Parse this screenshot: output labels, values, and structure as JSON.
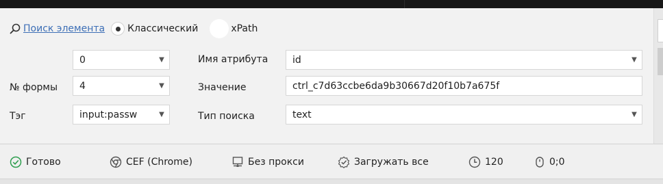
{
  "search": {
    "link_label": "Поиск элемента",
    "mode_classic": "Классический",
    "mode_xpath": "xPath",
    "selected_mode": "classic"
  },
  "form": {
    "index_value": "0",
    "form_number_label": "№ формы",
    "form_number_value": "4",
    "tag_label": "Тэг",
    "tag_value": "input:passw",
    "attr_name_label": "Имя атрибута",
    "attr_name_value": "id",
    "value_label": "Значение",
    "value_value": "ctrl_c7d63ccbe6da9b30667d20f10b7a675f",
    "search_type_label": "Тип поиска",
    "search_type_value": "text"
  },
  "status": {
    "ready": "Готово",
    "engine": "CEF (Chrome)",
    "proxy": "Без прокси",
    "load": "Загружать все",
    "timeout": "120",
    "coords": "0;0"
  },
  "colors": {
    "link": "#3d6fb6",
    "ready_icon": "#2e9e4f",
    "icon_gray": "#555555"
  }
}
